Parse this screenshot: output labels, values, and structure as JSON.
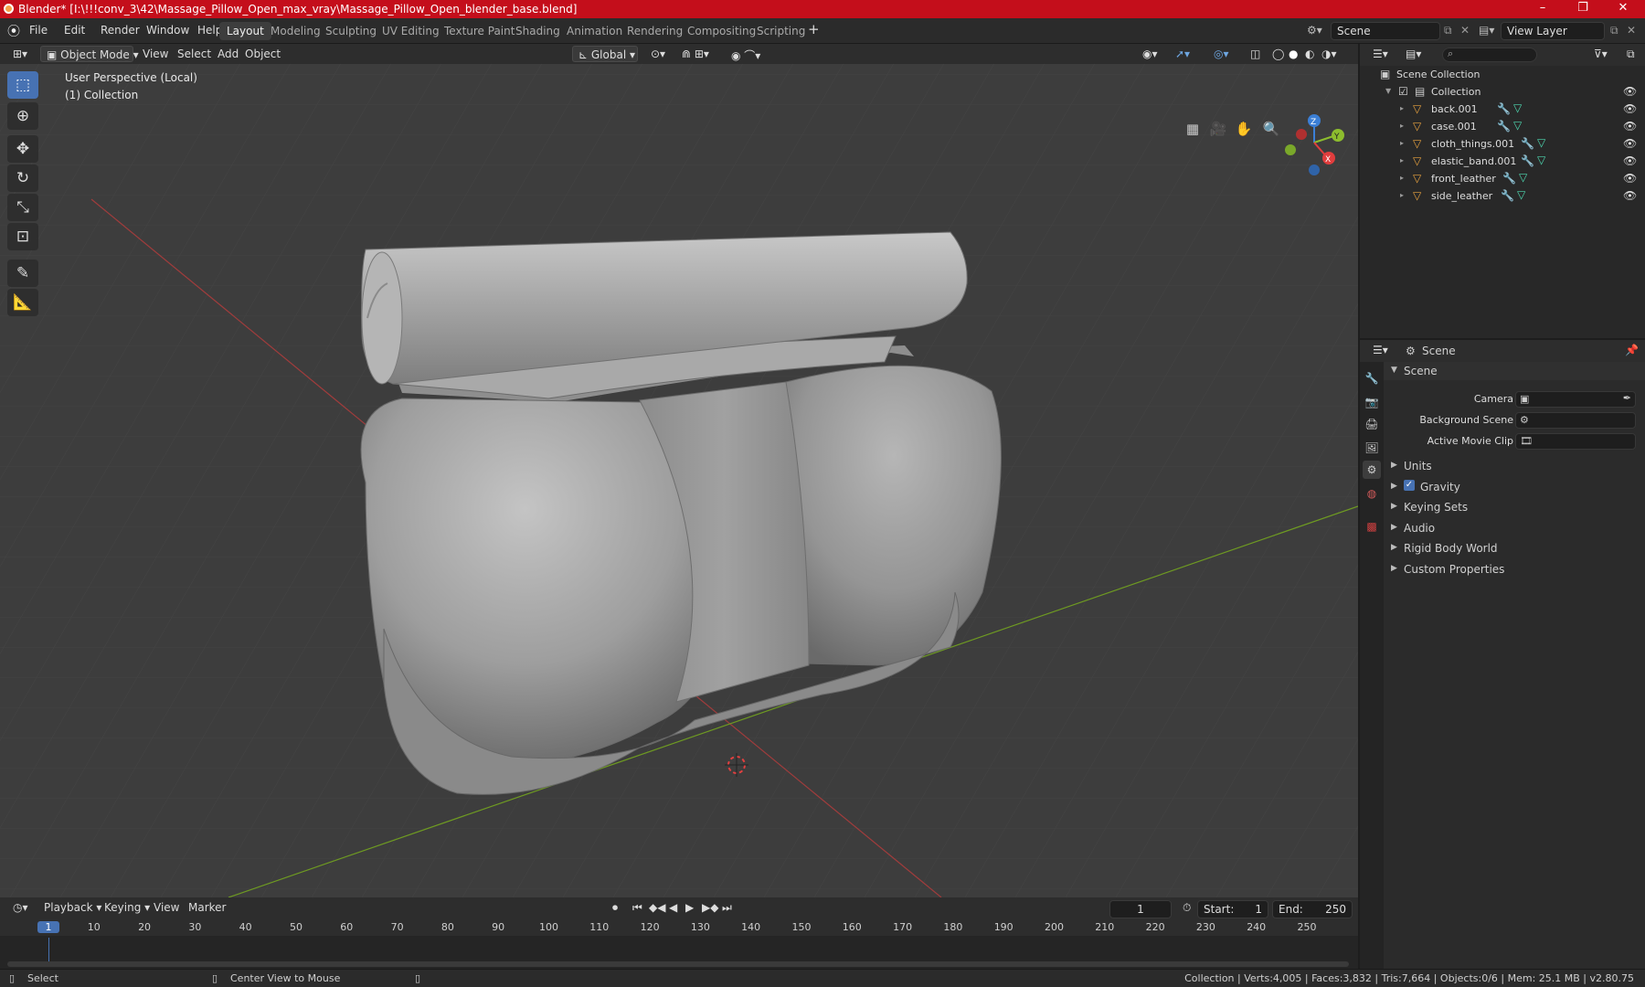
{
  "titlebar": {
    "title": "Blender* [I:\\!!!conv_3\\42\\Massage_Pillow_Open_max_vray\\Massage_Pillow_Open_blender_base.blend]",
    "minimize": "–",
    "maximize": "❐",
    "close": "✕"
  },
  "menu": {
    "file": "File",
    "edit": "Edit",
    "render": "Render",
    "window": "Window",
    "help": "Help"
  },
  "workspaces": [
    "Layout",
    "Modeling",
    "Sculpting",
    "UV Editing",
    "Texture Paint",
    "Shading",
    "Animation",
    "Rendering",
    "Compositing",
    "Scripting"
  ],
  "workspace_add": "+",
  "scene": {
    "name": "Scene",
    "view_layer": "View Layer"
  },
  "viewport": {
    "mode": "Object Mode",
    "view": "View",
    "select": "Select",
    "add": "Add",
    "object": "Object",
    "orientation": "Global",
    "overlay_line1": "User Perspective (Local)",
    "overlay_line2": "(1) Collection",
    "gizmo": {
      "x": "X",
      "y": "Y",
      "z": "Z"
    }
  },
  "outliner": {
    "search_placeholder": "",
    "root": "Scene Collection",
    "collection": "Collection",
    "items": [
      "back.001",
      "case.001",
      "cloth_things.001",
      "elastic_band.001",
      "front_leather",
      "side_leather"
    ]
  },
  "properties": {
    "header": "Scene",
    "section": "Scene",
    "camera_label": "Camera",
    "bg_scene_label": "Background Scene",
    "movie_clip_label": "Active Movie Clip",
    "panels": [
      "Units",
      "Gravity",
      "Keying Sets",
      "Audio",
      "Rigid Body World",
      "Custom Properties"
    ]
  },
  "timeline": {
    "playback": "Playback",
    "keying": "Keying",
    "view": "View",
    "marker": "Marker",
    "current_frame": "1",
    "start_label": "Start:",
    "start": "1",
    "end_label": "End:",
    "end": "250",
    "ticks": [
      "1",
      "10",
      "20",
      "30",
      "40",
      "50",
      "60",
      "70",
      "80",
      "90",
      "100",
      "110",
      "120",
      "130",
      "140",
      "150",
      "160",
      "170",
      "180",
      "190",
      "200",
      "210",
      "220",
      "230",
      "240",
      "250"
    ]
  },
  "statusbar": {
    "select": "Select",
    "center": "Center View to Mouse",
    "stats": "Collection | Verts:4,005 | Faces:3,832 | Tris:7,664 | Objects:0/6 | Mem: 25.1 MB | v2.80.75"
  },
  "colors": {
    "accent": "#4772b3",
    "titlebar": "#c40e1b",
    "x_axis": "#e03d3d",
    "y_axis": "#8dbd2e",
    "z_axis": "#3b7fd6"
  }
}
